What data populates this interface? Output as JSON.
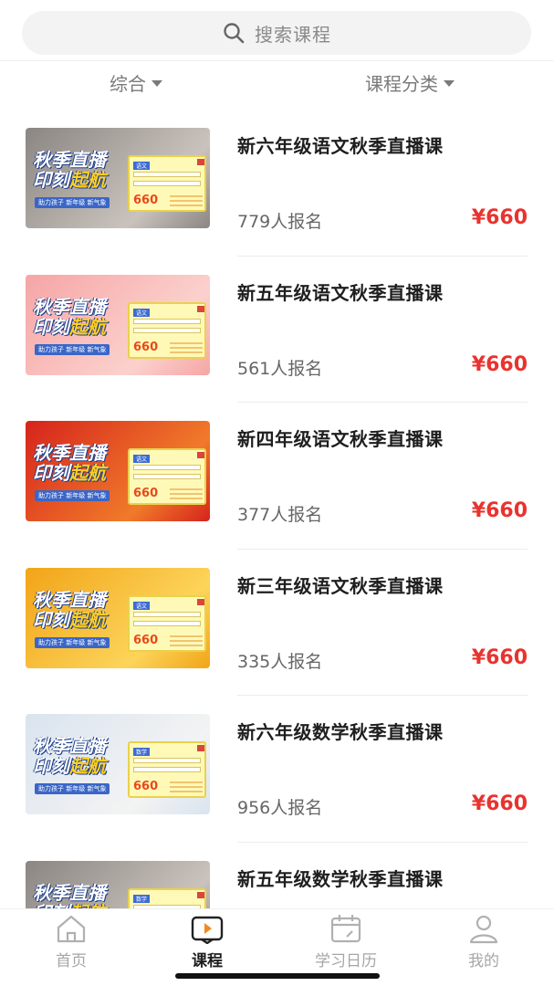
{
  "search": {
    "placeholder": "搜索课程",
    "icon": "search-icon"
  },
  "filters": {
    "all": {
      "label": "综合",
      "icon": "caret-down-icon"
    },
    "category": {
      "label": "课程分类",
      "icon": "caret-down-icon"
    }
  },
  "thumbnail_text": {
    "headline_1": "秋季直播",
    "headline_2a": "印刻",
    "headline_2b": "起航",
    "slogan": "助力孩子 新年级 新气象",
    "price": "660"
  },
  "courses": [
    {
      "title": "新六年级语文秋季直播课",
      "enroll": "779人报名",
      "price": "¥660",
      "bg": "#8b8682",
      "bg2": "#c9c2bd",
      "tag": "语文"
    },
    {
      "title": "新五年级语文秋季直播课",
      "enroll": "561人报名",
      "price": "¥660",
      "bg": "#f6a5a5",
      "bg2": "#fbd1cd",
      "tag": "语文"
    },
    {
      "title": "新四年级语文秋季直播课",
      "enroll": "377人报名",
      "price": "¥660",
      "bg": "#d6231c",
      "bg2": "#f07a2a",
      "tag": "语文"
    },
    {
      "title": "新三年级语文秋季直播课",
      "enroll": "335人报名",
      "price": "¥660",
      "bg": "#f2a418",
      "bg2": "#fcd45a",
      "tag": "语文"
    },
    {
      "title": "新六年级数学秋季直播课",
      "enroll": "956人报名",
      "price": "¥660",
      "bg": "#d9e4ef",
      "bg2": "#f3f3f3",
      "tag": "数学"
    },
    {
      "title": "新五年级数学秋季直播课",
      "enroll": "",
      "price": "",
      "bg": "#8b8682",
      "bg2": "#c9c2bd",
      "tag": "数学"
    }
  ],
  "tabbar": {
    "home": {
      "label": "首页",
      "icon": "home-icon"
    },
    "course": {
      "label": "课程",
      "icon": "course-play-icon"
    },
    "calendar": {
      "label": "学习日历",
      "icon": "calendar-icon"
    },
    "me": {
      "label": "我的",
      "icon": "user-icon"
    }
  },
  "colors": {
    "accent": "#e8332f",
    "active_tab": "#1e1e1e",
    "inactive_tab": "#a6a6a6",
    "course_icon_accent": "#f08a1c"
  }
}
